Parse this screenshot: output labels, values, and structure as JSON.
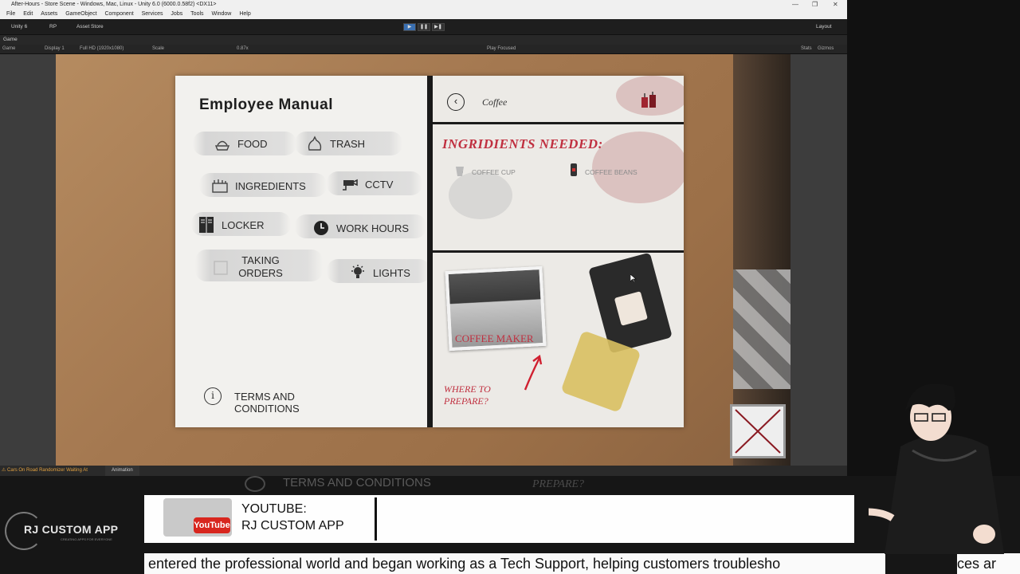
{
  "window": {
    "title": "After-Hours - Store Scene - Windows, Mac, Linux - Unity 6.0 (6000.0.58f2) <DX11>",
    "controls": {
      "minimize": "—",
      "maximize": "❐",
      "close": "✕"
    }
  },
  "menu": [
    "File",
    "Edit",
    "Assets",
    "GameObject",
    "Component",
    "Services",
    "Jobs",
    "Tools",
    "Window",
    "Help"
  ],
  "toolbar": {
    "account": "Unity 6",
    "rp": "RP",
    "asset_store": "Asset Store",
    "play": "▶",
    "pause": "❚❚",
    "step": "▶❚",
    "layout": "Layout"
  },
  "game_tab": {
    "label": "Game"
  },
  "game_bar": {
    "mode": "Game",
    "display": "Display 1",
    "resolution": "Full HD (1920x1080)",
    "scale_label": "Scale",
    "scale_value": "0.87x",
    "play_focused": "Play Focused",
    "stats": "Stats",
    "gizmos": "Gizmos"
  },
  "manual": {
    "title": "Employee Manual",
    "buttons": [
      {
        "key": "food",
        "label": "FOOD"
      },
      {
        "key": "trash",
        "label": "TRASH"
      },
      {
        "key": "ingredients",
        "label": "INGREDIENTS"
      },
      {
        "key": "cctv",
        "label": "CCTV"
      },
      {
        "key": "locker",
        "label": "LOCKER"
      },
      {
        "key": "work-hours",
        "label": "WORK HOURS"
      },
      {
        "key": "taking-orders",
        "label": "TAKING ORDERS"
      },
      {
        "key": "lights",
        "label": "LIGHTS"
      }
    ],
    "terms": "TERMS AND CONDITIONS",
    "terms_icon": "i"
  },
  "recipe": {
    "back": "‹",
    "title": "Coffee",
    "ingredients_heading": "INGRIDIENTS NEEDED:",
    "ingredients": [
      "COFFEE CUP",
      "COFFEE BEANS"
    ],
    "maker_label": "COFFEE MAKER",
    "where_line1": "WHERE TO",
    "where_line2": "PREPARE?"
  },
  "status_bar": {
    "warning": "⚠ Cars On Road Randomizer Waiting At",
    "animation_tab": "Animation"
  },
  "overlay": {
    "ghost_terms": "TERMS AND CONDITIONS",
    "ghost_prepare": "PREPARE?",
    "logo_text": "RJ CUSTOM APP",
    "logo_sub": "CREATING APPS FOR EVERYONE",
    "yt_badge": "YouTube",
    "yt_line1": "YOUTUBE:",
    "yt_line2": "RJ CUSTOM APP",
    "ticker": "entered the professional world and began working as a Tech Support, helping customers troublesho",
    "ticker_end": "ces ar"
  },
  "colors": {
    "accent_red": "#c03040",
    "panel_dark": "#1e1e1e",
    "paper": "#f2f1ee"
  }
}
